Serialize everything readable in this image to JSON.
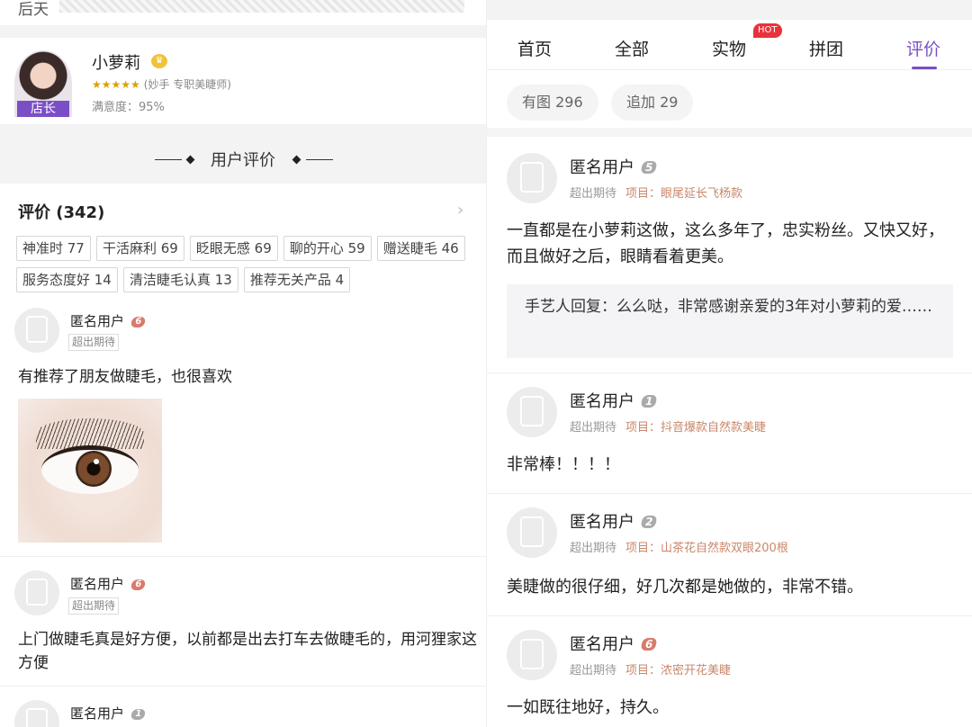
{
  "left": {
    "top_text": "后天",
    "shop": {
      "name": "小萝莉",
      "badge": "店长",
      "stars": "★★★★★",
      "subtitle": "(妙手 专职美睫师)",
      "satisfaction": "满意度：95%"
    },
    "section_title": "用户评价",
    "reviews_title": "评价 (342)",
    "tags": [
      "神准时 77",
      "干活麻利 69",
      "眨眼无感 69",
      "聊的开心 59",
      "赠送睫毛 46",
      "服务态度好 14",
      "清洁睫毛认真 13",
      "推荐无关产品 4"
    ],
    "comments": [
      {
        "user": "匿名用户",
        "level": "6",
        "pill": "超出期待",
        "text": "有推荐了朋友做睫毛，也很喜欢"
      },
      {
        "user": "匿名用户",
        "level": "6",
        "pill": "超出期待",
        "text": "上门做睫毛真是好方便，以前都是出去打车去做睫毛的，用河狸家这方便"
      },
      {
        "user": "匿名用户",
        "level": "1"
      }
    ]
  },
  "right": {
    "tabs": [
      "首页",
      "全部",
      "实物",
      "拼团",
      "评价"
    ],
    "active_tab": "评价",
    "hot_badge": "HOT",
    "filters": [
      "有图 296",
      "追加 29"
    ],
    "comments": [
      {
        "user": "匿名用户",
        "level": "5",
        "status": "超出期待",
        "project": "项目：眼尾延长飞杨款",
        "text": "一直都是在小萝莉这做，这么多年了，忠实粉丝。又快又好，而且做好之后，眼睛看着更美。",
        "reply": "手艺人回复：么么哒，非常感谢亲爱的3年对小萝莉的爱……"
      },
      {
        "user": "匿名用户",
        "level": "1",
        "status": "超出期待",
        "project": "项目：抖音爆款自然款美睫",
        "text": "非常棒！！！！"
      },
      {
        "user": "匿名用户",
        "level": "2",
        "status": "超出期待",
        "project": "项目：山茶花自然款双眼200根",
        "text": "美睫做的很仔细，好几次都是她做的，非常不错。"
      },
      {
        "user": "匿名用户",
        "level": "6",
        "status": "超出期待",
        "project": "项目：浓密开花美睫",
        "text": "一如既往地好，持久。"
      }
    ]
  },
  "colors": {
    "accent": "#7a4fc6",
    "hot": "#e8323b",
    "project": "#c9876a"
  },
  "icons": {
    "avatar": "anonymous-avatar-icon",
    "crown": "crown-icon",
    "arrow": "chevron-right-icon"
  }
}
